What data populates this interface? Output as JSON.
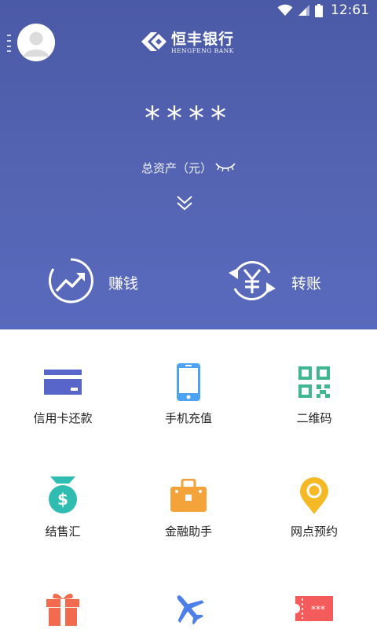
{
  "status_bar": {
    "time": "12:61"
  },
  "header": {
    "bank_name": "恒丰银行",
    "bank_name_en": "HENGFENG BANK"
  },
  "assets": {
    "masked_value": "****",
    "label": "总资产（元）"
  },
  "quick_actions": [
    {
      "label": "赚钱",
      "icon": "trend-up-icon"
    },
    {
      "label": "转账",
      "icon": "yuan-transfer-icon"
    }
  ],
  "services": [
    {
      "label": "信用卡还款",
      "icon": "credit-card-icon",
      "color": "#5865c9"
    },
    {
      "label": "手机充值",
      "icon": "mobile-phone-icon",
      "color": "#4da3f2"
    },
    {
      "label": "二维码",
      "icon": "qr-code-icon",
      "color": "#3fb88f"
    },
    {
      "label": "结售汇",
      "icon": "money-bag-icon",
      "color": "#2fbcb1"
    },
    {
      "label": "金融助手",
      "icon": "briefcase-icon",
      "color": "#f4a23a"
    },
    {
      "label": "网点预约",
      "icon": "location-pin-icon",
      "color": "#f5b925"
    },
    {
      "label": "",
      "icon": "gift-icon",
      "color": "#f26b4e"
    },
    {
      "label": "",
      "icon": "airplane-icon",
      "color": "#4d7fe8"
    },
    {
      "label": "",
      "icon": "ticket-icon",
      "color": "#f45b5b"
    }
  ],
  "colors": {
    "hero_top": "#4b5aa6",
    "hero_bottom": "#5969bd"
  }
}
